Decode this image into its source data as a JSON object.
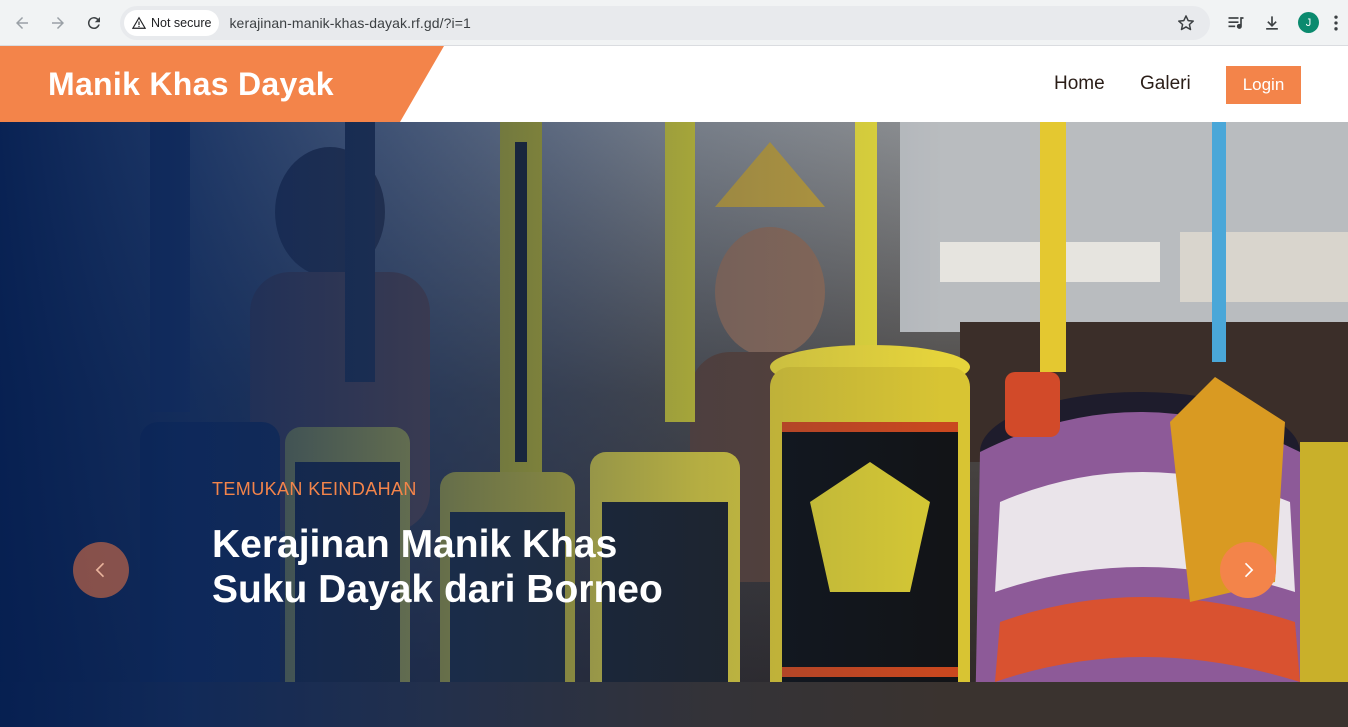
{
  "browser": {
    "security_label": "Not secure",
    "url": "kerajinan-manik-khas-dayak.rf.gd/?i=1",
    "profile_initial": "J",
    "icons": [
      "back-arrow-icon",
      "forward-arrow-icon",
      "reload-icon",
      "warning-icon",
      "star-icon",
      "media-controls-icon",
      "download-icon",
      "kebab-menu-icon"
    ]
  },
  "header": {
    "brand": "Manik Khas Dayak",
    "nav": [
      {
        "label": "Home"
      },
      {
        "label": "Galeri"
      }
    ],
    "login_label": "Login",
    "brand_color": "#f3844a"
  },
  "hero": {
    "eyebrow": "TEMUKAN KEINDAHAN",
    "headline_line1": "Kerajinan Manik Khas",
    "headline_line2": "Suku Dayak dari Borneo",
    "prev_icon": "chevron-left-icon",
    "next_icon": "chevron-right-icon",
    "overlay_color": "#051f52"
  }
}
